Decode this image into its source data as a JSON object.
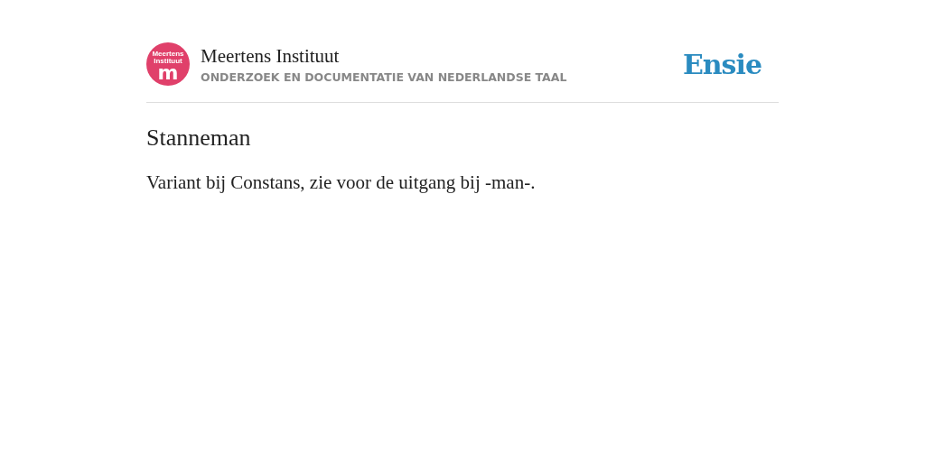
{
  "header": {
    "logo_text": "Meertens Instituut",
    "logo_letter": "m",
    "title": "Meertens Instituut",
    "subtitle": "ONDERZOEK EN DOCUMENTATIE VAN NEDERLANDSE TAAL",
    "brand": "Ensie"
  },
  "article": {
    "title": "Stanneman",
    "body": "Variant bij Constans, zie voor de uitgang bij -man-."
  }
}
